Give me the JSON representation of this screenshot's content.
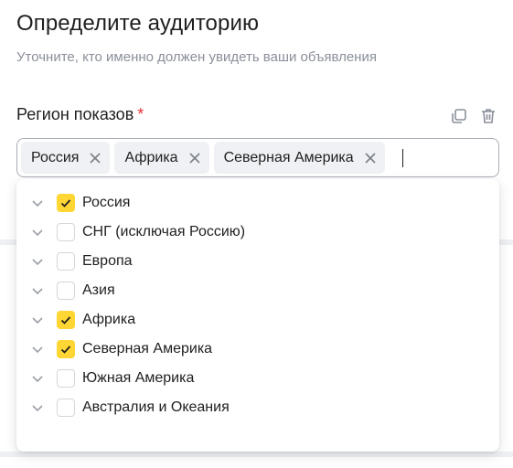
{
  "header": {
    "title": "Определите аудиторию",
    "subtitle": "Уточните, кто именно должен увидеть ваши объявления"
  },
  "region_field": {
    "label": "Регион показов",
    "required_mark": "*",
    "chips": [
      {
        "label": "Россия"
      },
      {
        "label": "Африка"
      },
      {
        "label": "Северная Америка"
      }
    ]
  },
  "dropdown": {
    "items": [
      {
        "label": "Россия",
        "checked": true
      },
      {
        "label": "СНГ (исключая Россию)",
        "checked": false
      },
      {
        "label": "Европа",
        "checked": false
      },
      {
        "label": "Азия",
        "checked": false
      },
      {
        "label": "Африка",
        "checked": true
      },
      {
        "label": "Северная Америка",
        "checked": true
      },
      {
        "label": "Южная Америка",
        "checked": false
      },
      {
        "label": "Австралия и Океания",
        "checked": false
      }
    ]
  },
  "colors": {
    "accent": "#ffd633",
    "required": "#e8333a",
    "muted_text": "#8a8f99",
    "chip_bg": "#f0f1f4"
  },
  "icons": {
    "copy": "copy-icon",
    "delete": "trash-icon",
    "chip_remove": "close-icon",
    "expand": "chevron-down-icon",
    "check": "check-icon"
  }
}
